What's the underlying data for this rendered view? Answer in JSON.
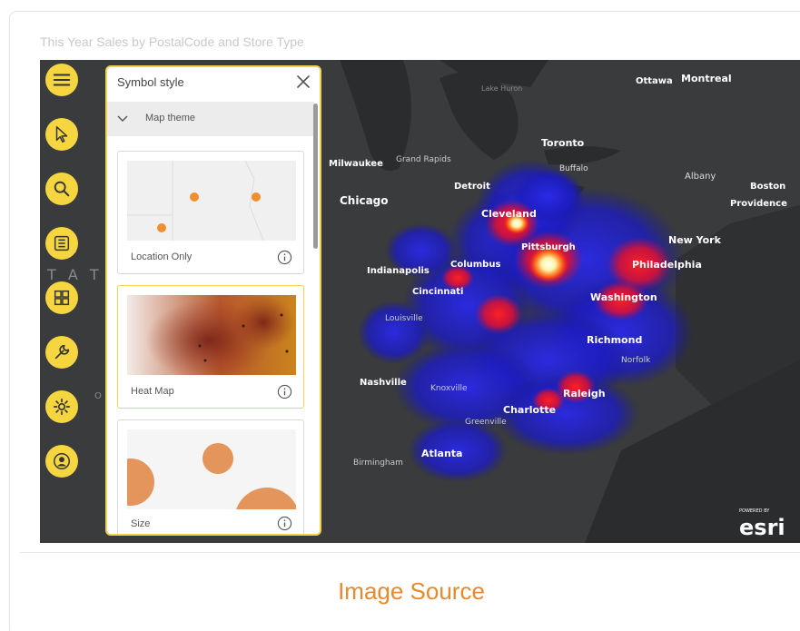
{
  "visual": {
    "title": "This Year Sales by PostalCode and Store Type"
  },
  "caption": {
    "text": "Image Source"
  },
  "toolbar": {
    "items": [
      {
        "icon": "menu-icon"
      },
      {
        "icon": "pointer-icon"
      },
      {
        "icon": "search-icon"
      },
      {
        "icon": "layers-list-icon"
      },
      {
        "icon": "basemap-grid-icon"
      },
      {
        "icon": "wrench-icon"
      },
      {
        "icon": "gear-icon"
      },
      {
        "icon": "user-icon"
      }
    ]
  },
  "panel": {
    "title": "Symbol style",
    "theme_section": "Map theme",
    "options": [
      {
        "label": "Location Only",
        "selected": false
      },
      {
        "label": "Heat Map",
        "selected": true
      },
      {
        "label": "Size",
        "selected": false
      }
    ]
  },
  "map": {
    "background_color": "#333436",
    "attribution": "esri",
    "attribution_small": "POWERED BY",
    "background_text": [
      "T E",
      "T A T E",
      "O"
    ],
    "water_labels": [
      "Lake Huron"
    ],
    "cities": [
      "Ottawa",
      "Montreal",
      "Toronto",
      "Buffalo",
      "Albany",
      "Boston",
      "Providence",
      "Milwaukee",
      "Grand Rapids",
      "Detroit",
      "Chicago",
      "Cleveland",
      "Pittsburgh",
      "New York",
      "Philadelphia",
      "Indianapolis",
      "Columbus",
      "Cincinnati",
      "Washington",
      "Louisville",
      "Richmond",
      "Norfolk",
      "Nashville",
      "Knoxville",
      "Raleigh",
      "Charlotte",
      "Greenville",
      "Atlanta",
      "Birmingham"
    ]
  }
}
